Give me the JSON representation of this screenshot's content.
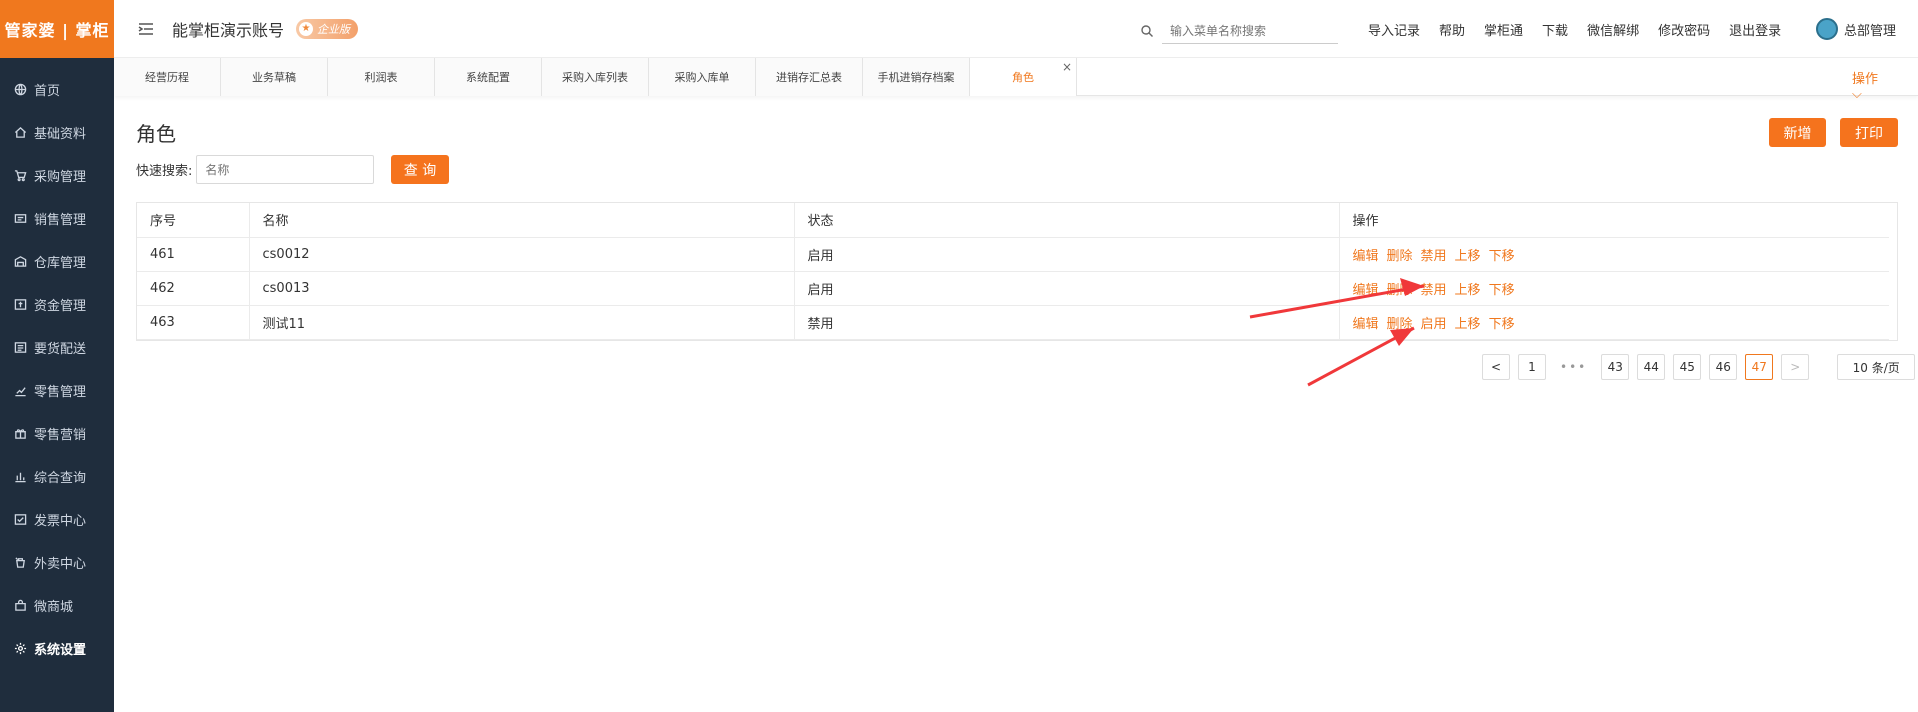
{
  "brand": {
    "logo_text": "管家婆 | 掌柜",
    "accent": "#f5731d",
    "sidebar_bg": "#1f2d3d"
  },
  "sidebar": {
    "items": [
      {
        "label": "首页",
        "icon": "globe-icon"
      },
      {
        "label": "基础资料",
        "icon": "home-icon"
      },
      {
        "label": "采购管理",
        "icon": "cart-icon"
      },
      {
        "label": "销售管理",
        "icon": "register-icon"
      },
      {
        "label": "仓库管理",
        "icon": "warehouse-icon"
      },
      {
        "label": "资金管理",
        "icon": "money-icon"
      },
      {
        "label": "要货配送",
        "icon": "delivery-icon"
      },
      {
        "label": "零售管理",
        "icon": "chart-icon"
      },
      {
        "label": "零售营销",
        "icon": "gift-icon"
      },
      {
        "label": "综合查询",
        "icon": "bar-chart-icon"
      },
      {
        "label": "发票中心",
        "icon": "invoice-icon"
      },
      {
        "label": "外卖中心",
        "icon": "takeout-icon"
      },
      {
        "label": "微商城",
        "icon": "shop-icon"
      },
      {
        "label": "系统设置",
        "icon": "gear-icon",
        "active": true
      }
    ]
  },
  "header": {
    "account_title": "能掌柜演示账号",
    "badge": "企业版",
    "search_placeholder": "输入菜单名称搜索",
    "links": [
      "导入记录",
      "帮助",
      "掌柜通",
      "下载",
      "微信解绑",
      "修改密码",
      "退出登录"
    ],
    "user_name": "总部管理"
  },
  "tabs": {
    "items": [
      "经营历程",
      "业务草稿",
      "利润表",
      "系统配置",
      "采购入库列表",
      "采购入库单",
      "进销存汇总表",
      "手机进销存档案",
      "角色"
    ],
    "active_index": 8,
    "ops_label": "操作"
  },
  "page": {
    "title": "角色",
    "add_label": "新增",
    "print_label": "打印",
    "quick_search_label": "快速搜索:",
    "quick_search_placeholder": "名称",
    "query_label": "查 询"
  },
  "table": {
    "headers": [
      "序号",
      "名称",
      "状态",
      "操作"
    ],
    "rows": [
      {
        "no": "461",
        "name": "cs0012",
        "state": "启用",
        "ops": [
          "编辑",
          "删除",
          "禁用",
          "上移",
          "下移"
        ]
      },
      {
        "no": "462",
        "name": "cs0013",
        "state": "启用",
        "ops": [
          "编辑",
          "删除",
          "禁用",
          "上移",
          "下移"
        ]
      },
      {
        "no": "463",
        "name": "测试11",
        "state": "禁用",
        "ops": [
          "编辑",
          "删除",
          "启用",
          "上移",
          "下移"
        ]
      }
    ]
  },
  "pagination": {
    "prev": "<",
    "pages": [
      "1",
      "43",
      "44",
      "45",
      "46",
      "47"
    ],
    "ellipsis": "•••",
    "current": "47",
    "next": ">",
    "page_size": "10 条/页"
  },
  "annotation_color": "#f0383a"
}
